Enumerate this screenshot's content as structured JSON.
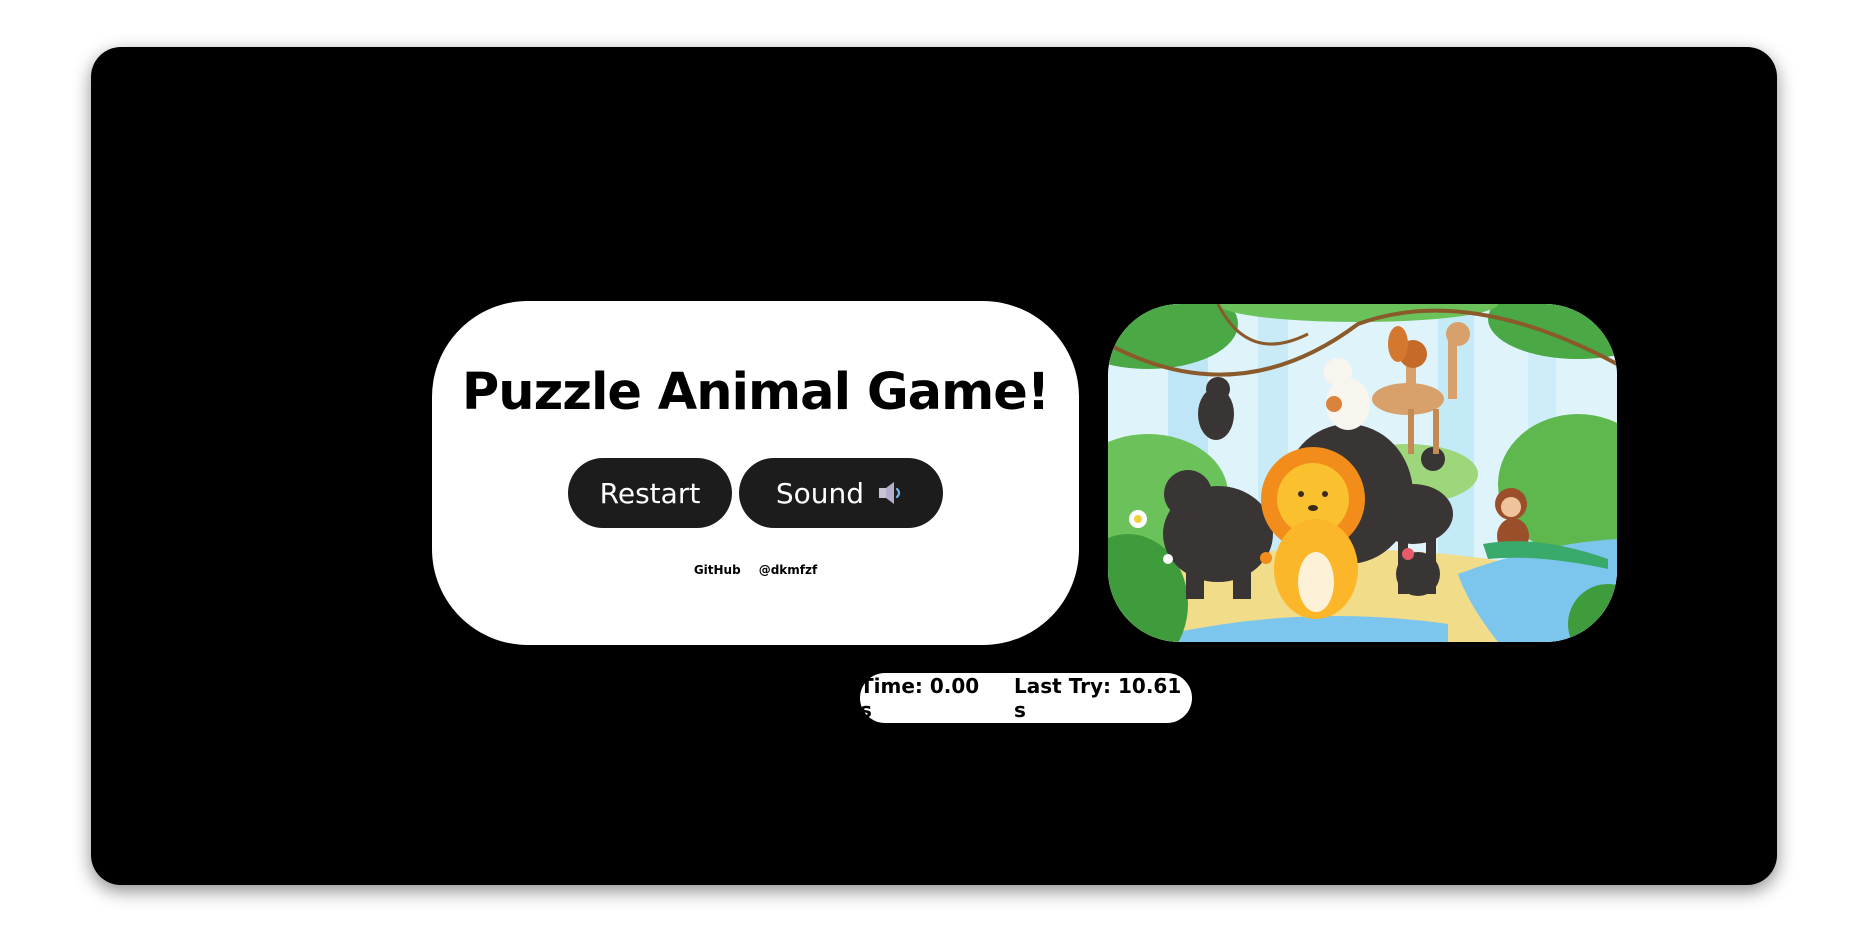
{
  "game": {
    "title": "Puzzle Animal Game!",
    "restart_label": "Restart",
    "sound_label": "Sound",
    "sound_icon": "speaker-icon",
    "links": [
      "GitHub",
      "@dkmfzf"
    ],
    "puzzle_image": "jungle-animals-illustration"
  },
  "status": {
    "time_label": "Time: 0.00 s",
    "last_try_label": "Last Try: 10.61 s"
  },
  "colors": {
    "background": "#000000",
    "panel": "#ffffff",
    "button": "#1c1c1c"
  }
}
